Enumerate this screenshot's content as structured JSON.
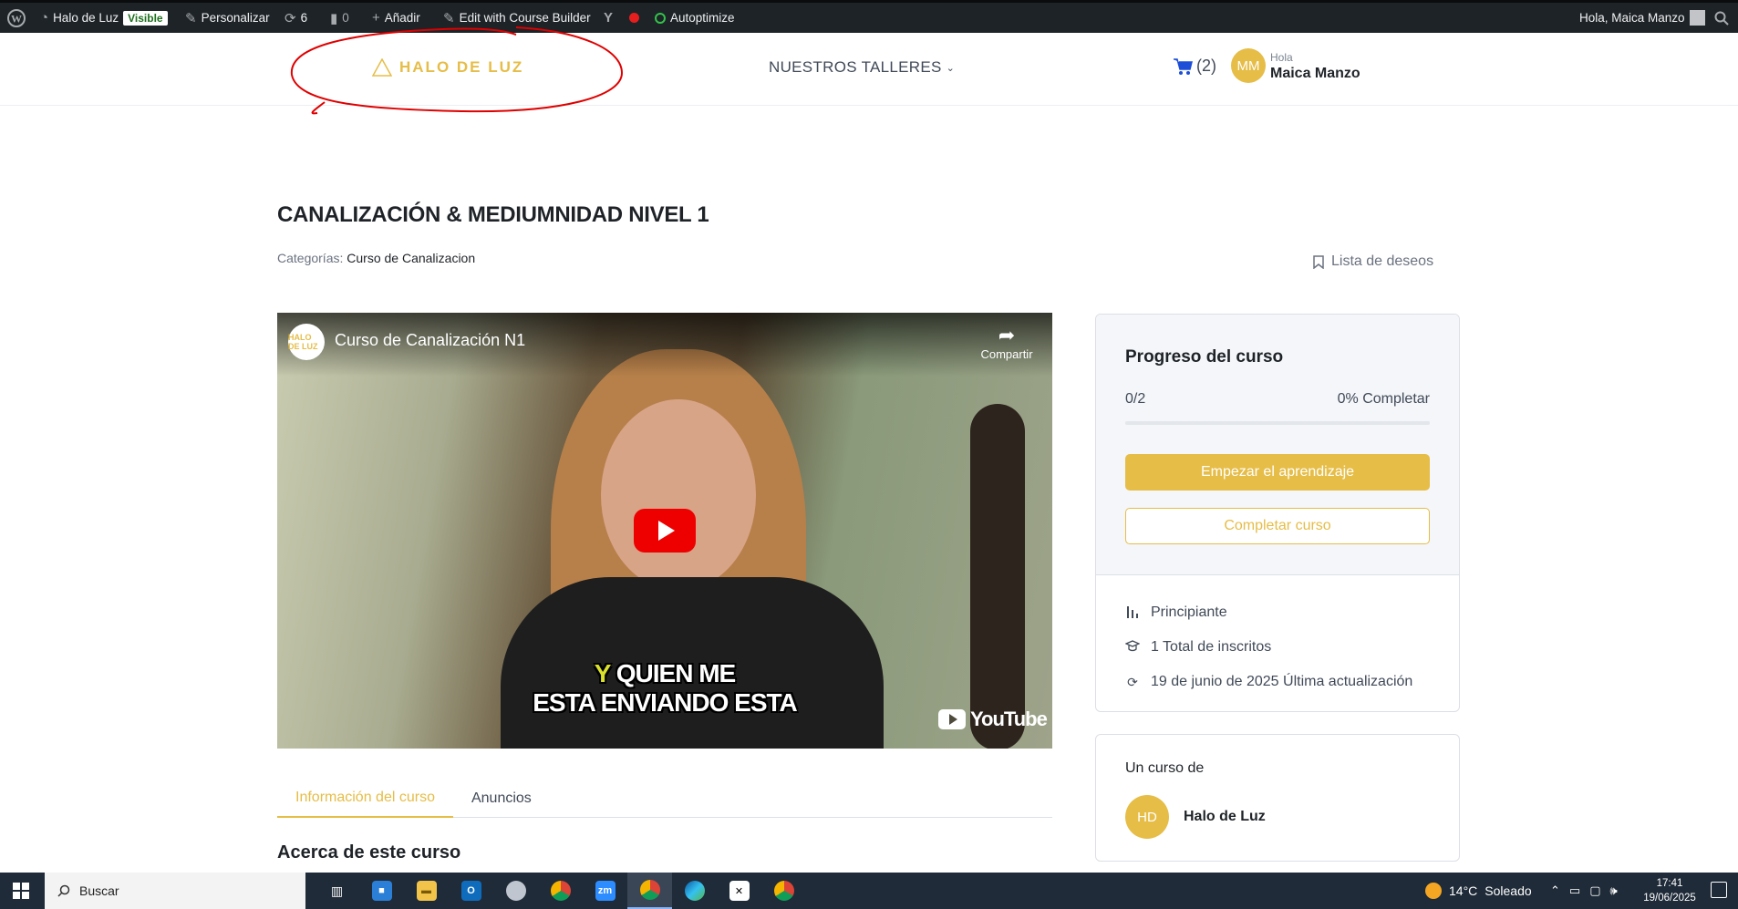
{
  "adminbar": {
    "site_name": "Halo de Luz",
    "visible_badge": "Visible",
    "customize": "Personalizar",
    "updates_count": "6",
    "comments_count": "0",
    "add_new": "Añadir",
    "edit_course_builder": "Edit with Course Builder",
    "autoptimize": "Autoptimize",
    "greeting": "Hola, Maica Manzo"
  },
  "header": {
    "logo_text": "HALO DE LUZ",
    "nav_workshops": "NUESTROS TALLERES",
    "cart_count": "(2)",
    "user_initials": "MM",
    "user_hello": "Hola",
    "user_name": "Maica Manzo"
  },
  "course": {
    "title": "CANALIZACIÓN & MEDIUMNIDAD NIVEL 1",
    "categories_label": "Categorías:",
    "category": "Curso de Canalizacion",
    "wishlist": "Lista de deseos"
  },
  "video": {
    "channel_logo": "HALO DE LUZ",
    "title": "Curso de Canalización N1",
    "share_label": "Compartir",
    "subtitle_y": "Y",
    "subtitle_line1_rest": " QUIEN ME",
    "subtitle_line2": "ESTA ENVIANDO ESTA",
    "youtube_label": "YouTube"
  },
  "tabs": [
    {
      "label": "Información del curso",
      "active": true
    },
    {
      "label": "Anuncios",
      "active": false
    }
  ],
  "about_heading": "Acerca de este curso",
  "progress": {
    "title": "Progreso del curso",
    "count": "0/2",
    "percent_label": "0% Completar",
    "fraction": 0,
    "start_button": "Empezar el aprendizaje",
    "complete_button": "Completar curso"
  },
  "meta": {
    "level": "Principiante",
    "enrolled": "1 Total de inscritos",
    "updated": "19 de junio de 2025 Última actualización"
  },
  "author": {
    "label": "Un curso de",
    "initials": "HD",
    "name": "Halo de Luz"
  },
  "taskbar": {
    "search_placeholder": "Buscar",
    "weather_temp": "14°C",
    "weather_desc": "Soleado",
    "time": "17:41",
    "date": "19/06/2025"
  },
  "colors": {
    "accent": "#e6bd47",
    "adminbar": "#1d2327",
    "taskbar": "#1f2b38",
    "cart": "#1d4ed8",
    "youtube_red": "#ee0000"
  }
}
